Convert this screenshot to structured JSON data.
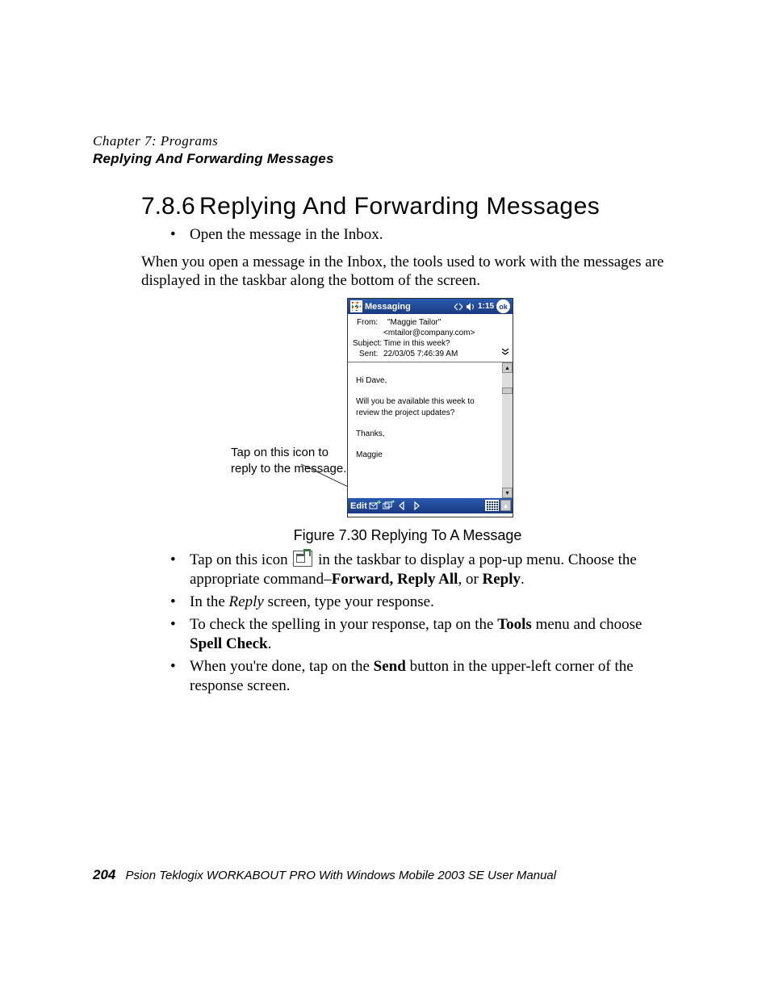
{
  "chapter_label": "Chapter 7:  Programs",
  "section_label": "Replying And Forwarding Messages",
  "heading_number": "7.8.6",
  "heading_title": "Replying And Forwarding Messages",
  "bullet_open": "Open the message in the Inbox.",
  "para_intro": "When you open a message in the Inbox, the tools used to work with the messages are displayed in the taskbar along the bottom of the screen.",
  "callout_text": "Tap on this icon to reply to the message.",
  "figure_caption": "Figure 7.30 Replying To A Message",
  "screenshot": {
    "titlebar": {
      "app_name": "Messaging",
      "time": "1:15",
      "ok": "ok"
    },
    "header": {
      "from_label": "From:",
      "from_value": "\"Maggie Tailor\"",
      "from_email": "<mtailor@company.com>",
      "subject_label": "Subject:",
      "subject_value": "Time in this week?",
      "sent_label": "Sent:",
      "sent_value": "22/03/05 7:46:39 AM"
    },
    "body": {
      "greeting": "Hi Dave,",
      "line1": "Will you  be available this week to review the project updates?",
      "signoff": "Thanks,",
      "name": "Maggie"
    },
    "bottombar": {
      "edit": "Edit"
    }
  },
  "bullets_after": {
    "b1_pre": "Tap on this icon ",
    "b1_post": " in the taskbar to display a pop-up menu. Choose the appropriate command–",
    "b1_bold": "Forward, Reply All",
    "b1_mid": ", or ",
    "b1_bold2": "Reply",
    "b1_end": ".",
    "b2_pre": "In the ",
    "b2_ital": "Reply",
    "b2_post": " screen, type your response.",
    "b3_pre": "To check the spelling in your response, tap on the ",
    "b3_bold1": "Tools",
    "b3_mid": " menu and choose ",
    "b3_bold2": "Spell Check",
    "b3_end": ".",
    "b4_pre": "When you're done, tap on the ",
    "b4_bold": "Send",
    "b4_post": " button in the upper-left corner of the response screen."
  },
  "footer": {
    "page": "204",
    "text": "Psion Teklogix WORKABOUT PRO With Windows Mobile 2003 SE User Manual"
  }
}
